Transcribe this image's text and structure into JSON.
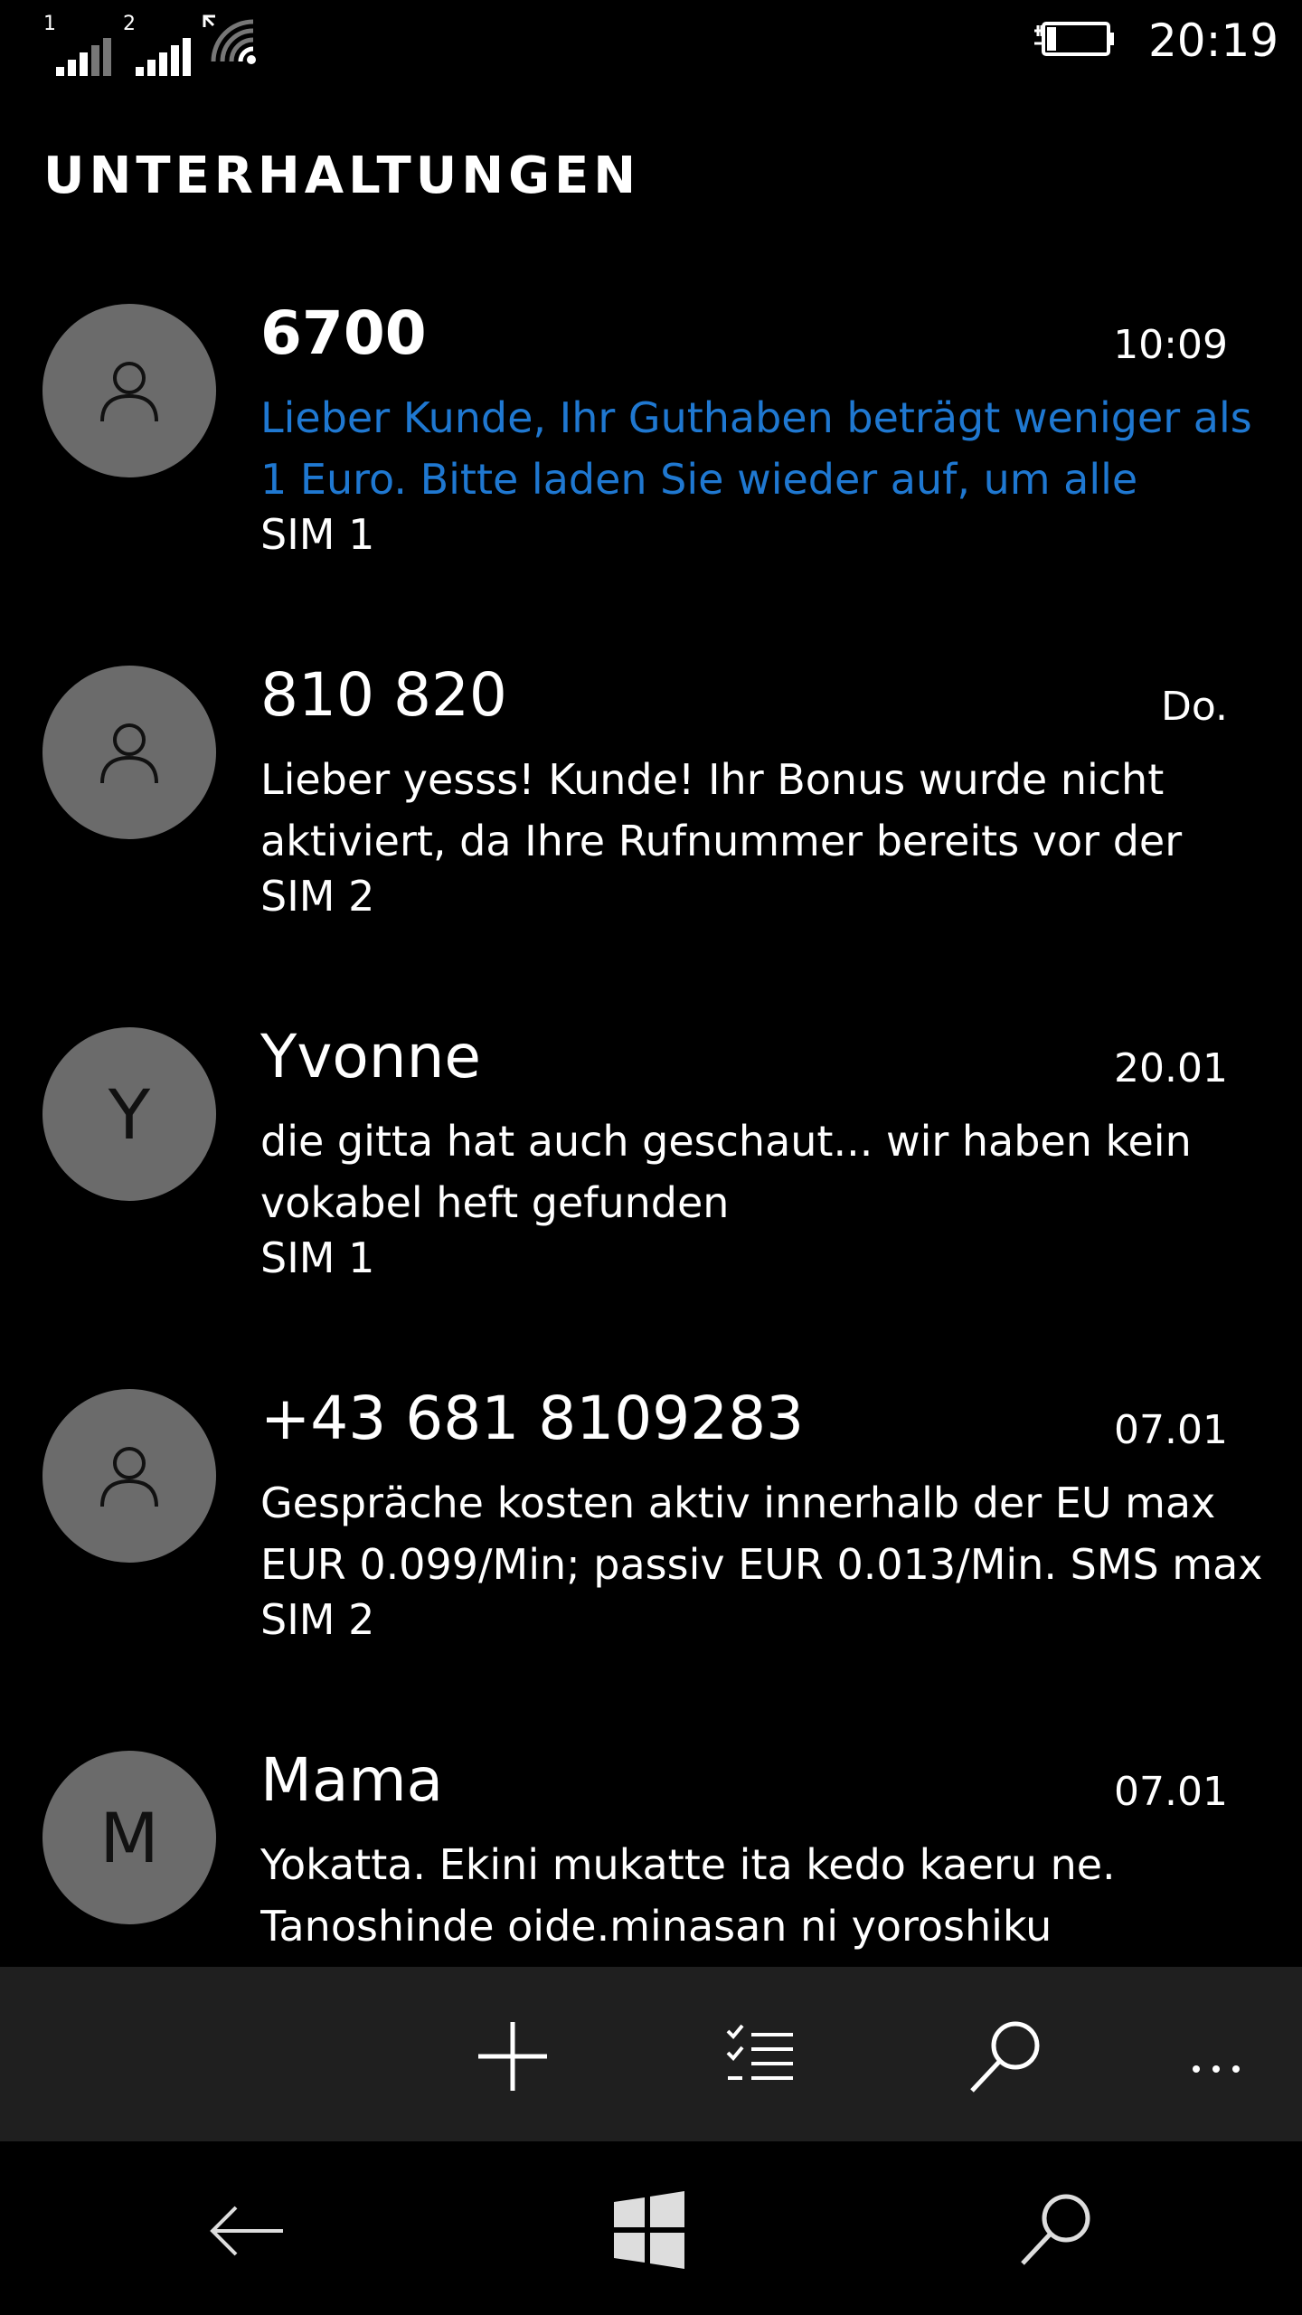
{
  "status_bar": {
    "sim1_label": "1",
    "sim2_label": "2",
    "time": "20:19"
  },
  "header": {
    "title": "UNTERHALTUNGEN"
  },
  "conversations": [
    {
      "name": "6700",
      "time": "10:09",
      "preview_line1": "Lieber Kunde, Ihr Guthaben beträgt weniger als",
      "preview_line2": "1 Euro. Bitte laden Sie wieder auf, um alle",
      "sim": "SIM 1",
      "avatar_letter": "",
      "unread": true
    },
    {
      "name": "810 820",
      "time": "Do.",
      "preview_line1": "Lieber yesss! Kunde! Ihr Bonus wurde nicht",
      "preview_line2": "aktiviert, da Ihre Rufnummer bereits vor der",
      "sim": "SIM 2",
      "avatar_letter": "",
      "unread": false
    },
    {
      "name": "Yvonne",
      "time": "20.01",
      "preview_line1": "die gitta hat auch geschaut... wir haben kein",
      "preview_line2": "vokabel heft gefunden",
      "sim": "SIM 1",
      "avatar_letter": "Y",
      "unread": false
    },
    {
      "name": "+43 681 8109283",
      "time": "07.01",
      "preview_line1": "Gespräche kosten aktiv innerhalb der EU max",
      "preview_line2": "EUR 0.099/Min; passiv EUR 0.013/Min. SMS max",
      "sim": "SIM 2",
      "avatar_letter": "",
      "unread": false
    },
    {
      "name": "Mama",
      "time": "07.01",
      "preview_line1": "Yokatta. Ekini mukatte ita kedo kaeru ne.",
      "preview_line2": "Tanoshinde oide.minasan ni yoroshiku",
      "sim": "",
      "avatar_letter": "M",
      "unread": false
    }
  ],
  "app_bar": {
    "buttons": [
      "add-icon",
      "select-icon",
      "search-icon",
      "more-icon"
    ],
    "more_label": "..."
  },
  "nav_bar": {
    "buttons": [
      "back-icon",
      "windows-icon",
      "search-icon"
    ]
  },
  "colors": {
    "background": "#000000",
    "accent": "#1f78d1",
    "avatar": "#6b6b6b",
    "app_bar": "#1f1f1f"
  }
}
